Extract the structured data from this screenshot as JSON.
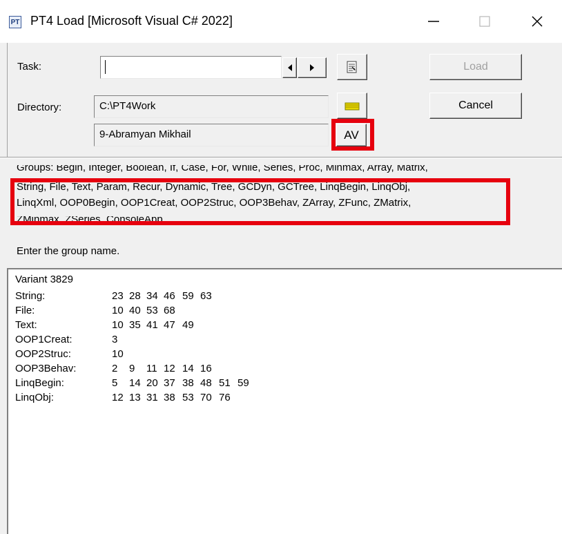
{
  "window": {
    "title": "PT4 Load [Microsoft Visual C# 2022]",
    "icon": "PT4-app-icon",
    "icon_text": "PT",
    "controls": [
      "minimize-icon",
      "maximize-icon",
      "close-icon"
    ]
  },
  "form": {
    "task_label": "Task:",
    "task_value": "",
    "directory_label": "Directory:",
    "directory_value": "C:\\PT4Work",
    "student_value": "9-Abramyan Mikhail",
    "av_button": "AV",
    "load_button": "Load",
    "cancel_button": "Cancel",
    "task_browse_icon": "task-list-icon",
    "dir_browse_icon": "folder-icon"
  },
  "info": {
    "groups_line1": "Groups: Begin, Integer, Boolean, If, Case, For, While, Series, Proc, Minmax, Array, Matrix,",
    "groups_line2": "String, File, Text, Param, Recur, Dynamic, Tree, GCDyn, GCTree, LinqBegin, LinqObj,",
    "groups_line3": "LinqXml, OOP0Begin, OOP1Creat, OOP2Struc, OOP3Behav, ZArray, ZFunc, ZMatrix,",
    "groups_line4": "ZMinmax, ZSeries, ConsoleApp.",
    "prompt": "Enter the group name."
  },
  "variant": {
    "title": "Variant 3829",
    "rows": [
      {
        "group": "String:",
        "tasks": [
          "23",
          "28",
          "34",
          "46",
          "59",
          "63"
        ]
      },
      {
        "group": "File:",
        "tasks": [
          "10",
          "40",
          "53",
          "68"
        ]
      },
      {
        "group": "Text:",
        "tasks": [
          "10",
          "35",
          "41",
          "47",
          "49"
        ]
      },
      {
        "group": "OOP1Creat:",
        "tasks": [
          "3"
        ]
      },
      {
        "group": "OOP2Struc:",
        "tasks": [
          "10"
        ]
      },
      {
        "group": "OOP3Behav:",
        "tasks": [
          "2",
          "9",
          "11",
          "12",
          "14",
          "16"
        ]
      },
      {
        "group": "LinqBegin:",
        "tasks": [
          "5",
          "14",
          "20",
          "37",
          "38",
          "48",
          "51",
          "59"
        ]
      },
      {
        "group": "LinqObj:",
        "tasks": [
          "12",
          "13",
          "31",
          "38",
          "53",
          "70",
          "76"
        ]
      }
    ]
  },
  "colors": {
    "highlight": "#e6000e",
    "dialog_bg": "#f0f0f0",
    "disabled_text": "#a0a0a0"
  }
}
